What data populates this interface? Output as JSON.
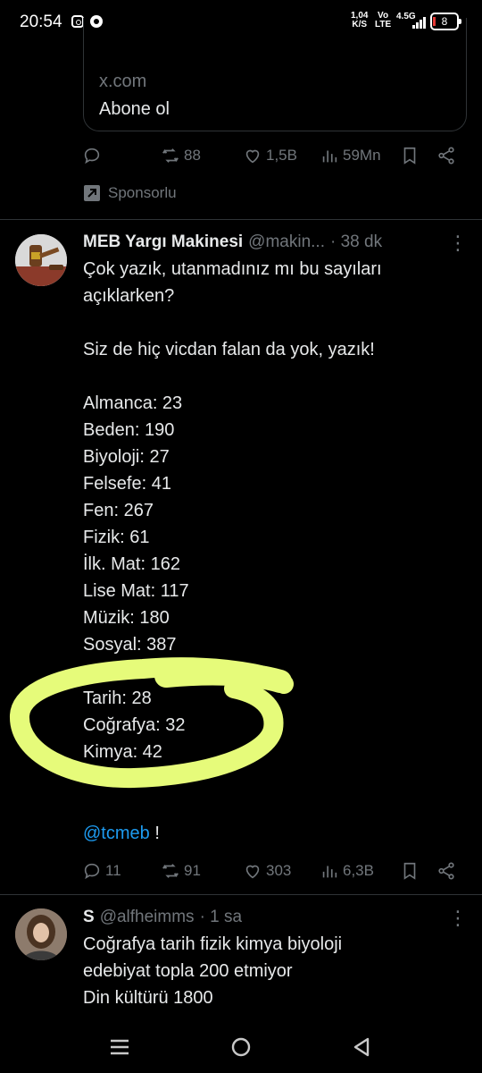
{
  "status_bar": {
    "time": "20:54",
    "net_speed_value": "1,04",
    "net_speed_unit": "K/S",
    "volte_top": "Vo",
    "volte_bottom": "LTE",
    "network": "4.5G",
    "battery": "8"
  },
  "previous_tweet": {
    "card": {
      "domain": "x.com",
      "subtitle": "Abone ol"
    },
    "actions": {
      "replies": "",
      "retweets": "88",
      "likes": "1,5B",
      "views": "59Mn"
    },
    "sponsored_label": "Sponsorlu"
  },
  "tweet": {
    "display_name": "MEB Yargı Makinesi",
    "handle": "@makin...",
    "time": "· 38 dk",
    "lines": [
      "Çok yazık, utanmadınız mı bu sayıları",
      "açıklarken?",
      "Siz de hiç vicdan falan da yok, yazık!",
      "Almanca: 23",
      "Beden: 190",
      "Biyoloji: 27",
      "Felsefe: 41",
      "Fen: 267",
      "Fizik: 61",
      "İlk. Mat: 162",
      "Lise Mat: 117",
      "Müzik: 180",
      "Sosyal: 387",
      "Tarih: 28",
      "Coğrafya: 32",
      "Kimya: 42"
    ],
    "mention": "@tcmeb",
    "mention_suffix": " !",
    "actions": {
      "replies": "11",
      "retweets": "91",
      "likes": "303",
      "views": "6,3B"
    },
    "highlight_color": "#e6fb7a"
  },
  "reply_tweet": {
    "display_name": "S",
    "handle": "@alfheimms",
    "time": "· 1 sa",
    "lines": [
      "Coğrafya tarih fizik kimya biyoloji",
      "edebiyat topla 200 etmiyor",
      "Din kültürü 1800"
    ]
  },
  "colors": {
    "background": "#000000",
    "text": "#e7e9ea",
    "muted": "#71767b",
    "link": "#1d9bf0",
    "divider": "#2f3336"
  }
}
